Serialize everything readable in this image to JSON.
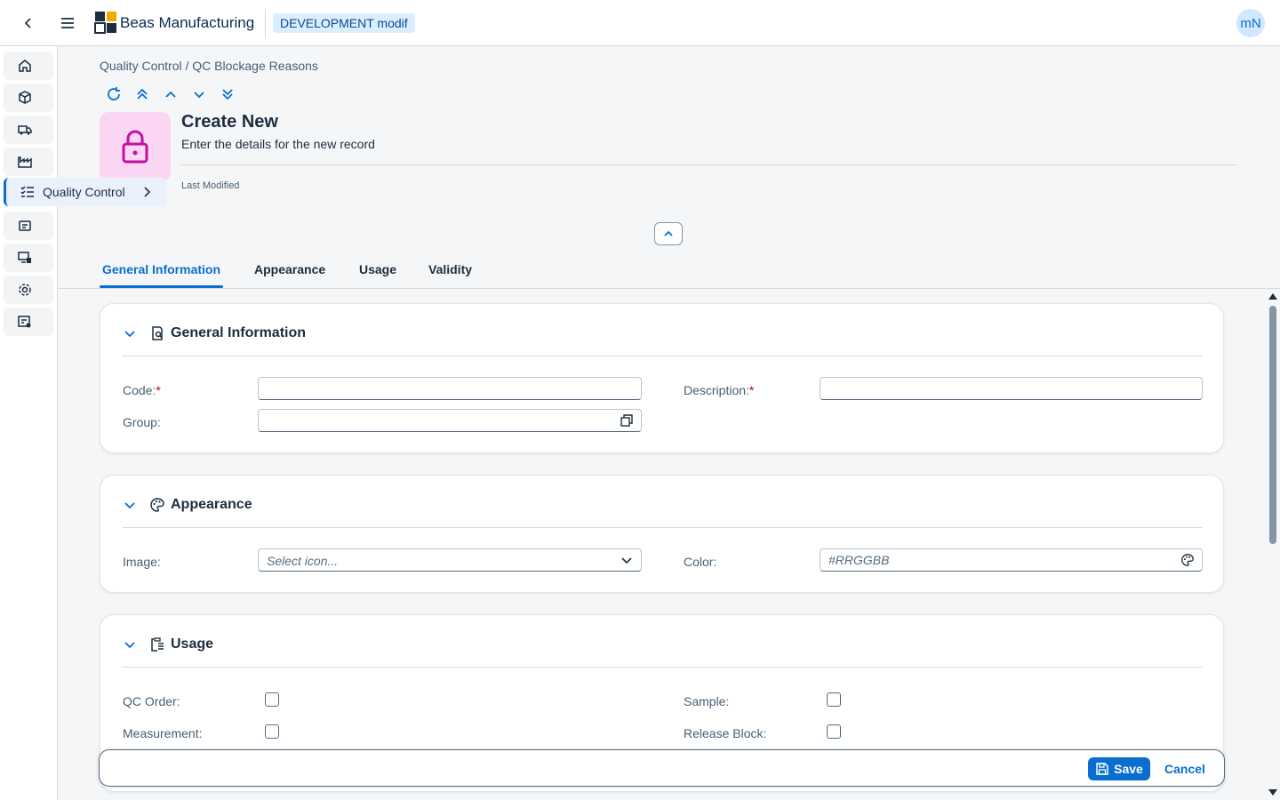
{
  "shell": {
    "app_name": "Beas Manufacturing",
    "environment": "DEVELOPMENT modif",
    "avatar_initials": "mN"
  },
  "sidebar": {
    "expanded_item_label": "Quality Control",
    "icons": [
      "home-icon",
      "cube-icon",
      "truck-icon",
      "factory-icon",
      "checklist-icon",
      "inventory-icon",
      "monitor-icon",
      "gear-icon",
      "report-icon"
    ]
  },
  "breadcrumb": "Quality Control / QC Blockage Reasons",
  "header": {
    "title": "Create New",
    "subtitle": "Enter the details for the new record",
    "last_modified_label": "Last Modified",
    "object_icon": "lock-icon"
  },
  "tabs": [
    {
      "label": "General Information",
      "active": true
    },
    {
      "label": "Appearance",
      "active": false
    },
    {
      "label": "Usage",
      "active": false
    },
    {
      "label": "Validity",
      "active": false
    }
  ],
  "sections": {
    "general": {
      "title": "General Information",
      "code_label": "Code:",
      "code_value": "",
      "description_label": "Description:",
      "description_value": "",
      "group_label": "Group:",
      "group_value": "",
      "required_marker": "*"
    },
    "appearance": {
      "title": "Appearance",
      "image_label": "Image:",
      "image_placeholder": "Select icon...",
      "color_label": "Color:",
      "color_placeholder": "#RRGGBB"
    },
    "usage": {
      "title": "Usage",
      "qc_order_label": "QC Order:",
      "sample_label": "Sample:",
      "measurement_label": "Measurement:",
      "release_block_label": "Release Block:"
    }
  },
  "footer": {
    "save_label": "Save",
    "cancel_label": "Cancel"
  },
  "colors": {
    "accent": "#0a6ed1",
    "object_icon_bg": "#fbd6f3",
    "object_icon_fg": "#c20fa2",
    "required": "#aa0808"
  }
}
